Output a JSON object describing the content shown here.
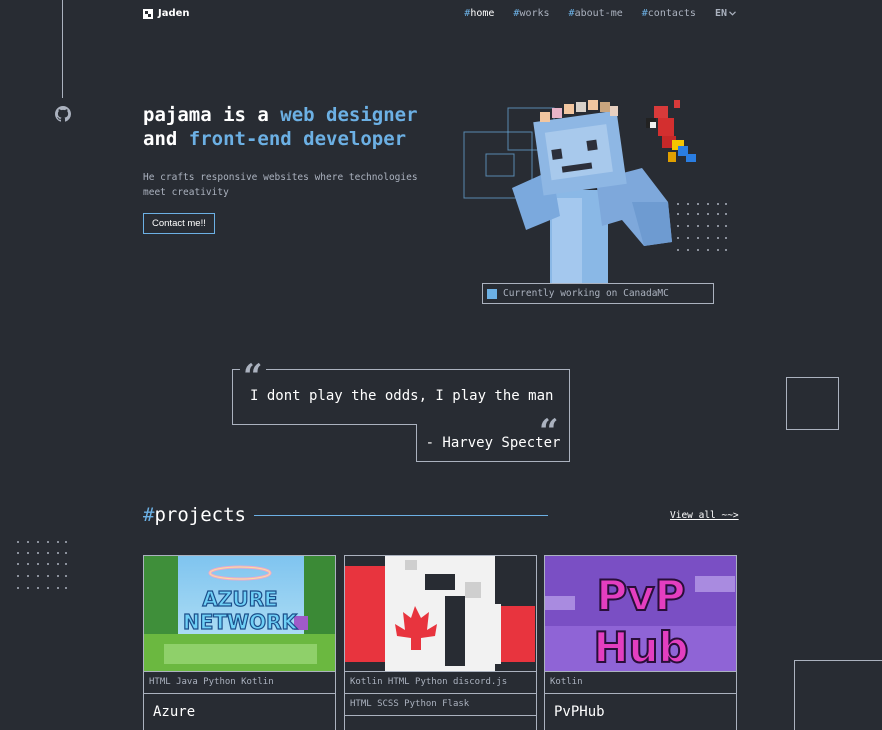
{
  "brand": {
    "name": "Jaden"
  },
  "nav": {
    "items": [
      {
        "hash": "#",
        "label": "home"
      },
      {
        "hash": "#",
        "label": "works"
      },
      {
        "hash": "#",
        "label": "about-me"
      },
      {
        "hash": "#",
        "label": "contacts"
      }
    ],
    "language": "EN"
  },
  "hero": {
    "title_line1_prefix": "pajama is a ",
    "title_line1_accent": "web designer",
    "title_line2_prefix": "and ",
    "title_line2_accent": "front-end developer",
    "subtitle": "He crafts responsive websites where technologies meet creativity",
    "contact_button": "Contact me!!",
    "status_text": "Currently working on CanadaMC"
  },
  "quote": {
    "text": "I dont play the odds, I play the man",
    "author": "- Harvey Specter"
  },
  "projects": {
    "hash": "#",
    "title": "projects",
    "view_all": "View all ~~>",
    "cards": [
      {
        "tags": "HTML Java Python Kotlin",
        "tags2": "",
        "title": "Azure",
        "image_text_1": "AZURE",
        "image_text_2": "NETWORK"
      },
      {
        "tags": "Kotlin HTML Python discord.js",
        "tags2": "HTML SCSS Python Flask",
        "title": "",
        "image_text_1": "",
        "image_text_2": ""
      },
      {
        "tags": "Kotlin",
        "tags2": "",
        "title": "PvPHub",
        "image_text_1": "PvP",
        "image_text_2": "Hub"
      }
    ]
  },
  "colors": {
    "background": "#282c33",
    "accent": "#6cb0e4",
    "gray": "#abb2bf"
  },
  "icons": [
    "github-icon",
    "logo-icon",
    "chevron-down-icon",
    "quote-icon",
    "squiggle-arrow-icon"
  ]
}
